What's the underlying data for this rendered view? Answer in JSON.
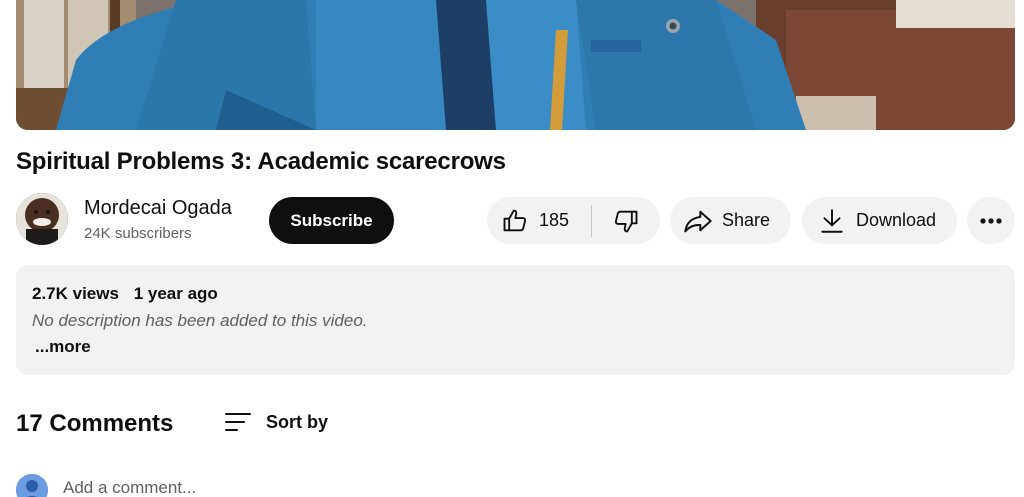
{
  "video": {
    "title": "Spiritual Problems 3: Academic scarecrows"
  },
  "channel": {
    "name": "Mordecai Ogada",
    "subscribers": "24K subscribers",
    "subscribe_label": "Subscribe"
  },
  "actions": {
    "like_count": "185",
    "share_label": "Share",
    "download_label": "Download"
  },
  "description": {
    "views": "2.7K views",
    "age": "1 year ago",
    "text": "No description has been added to this video.",
    "more_label": "...more"
  },
  "comments": {
    "count_label": "17 Comments",
    "sort_label": "Sort by",
    "input_placeholder": "Add a comment..."
  },
  "icons": {
    "like": "thumbs-up-icon",
    "dislike": "thumbs-down-icon",
    "share": "share-arrow-icon",
    "download": "download-icon",
    "more": "more-horizontal-icon",
    "sort": "sort-lines-icon"
  },
  "colors": {
    "text_primary": "#0f0f0f",
    "text_secondary": "#606060",
    "pill_bg": "#f2f2f2",
    "subscribe_bg": "#0f0f0f"
  }
}
